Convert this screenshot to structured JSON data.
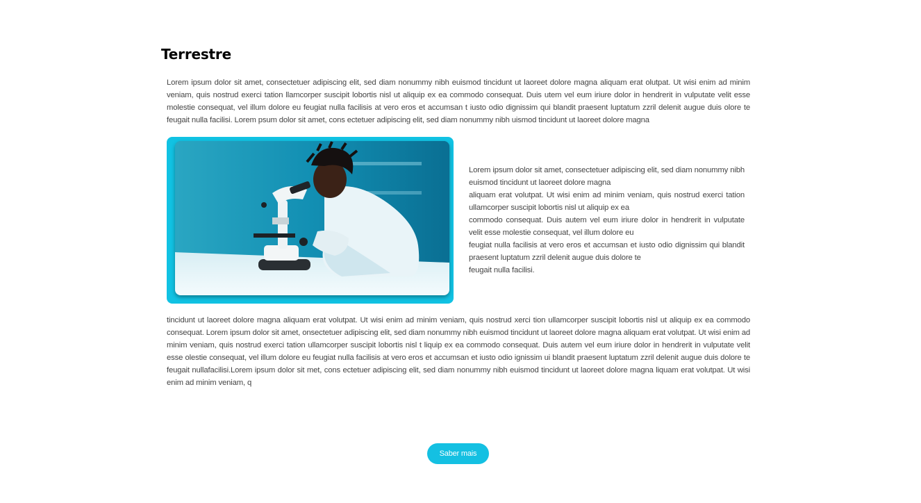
{
  "section": {
    "title": "Terrestre"
  },
  "intro_paragraph": "Lorem ipsum dolor sit amet, consectetuer adipiscing elit, sed diam nonummy nibh euismod tincidunt ut laoreet dolore magna aliquam erat  olutpat. Ut wisi enim ad minim veniam, quis nostrud exerci tation  llamcorper suscipit lobortis nisl ut aliquip ex ea commodo consequat. Duis utem vel eum iriure dolor in hendrerit in vulputate velit esse molestie  consequat, vel illum dolore eu feugiat nulla facilisis at vero eros et accumsan  t iusto odio dignissim qui blandit praesent luptatum zzril delenit augue duis  olore te feugait nulla facilisi. Lorem psum dolor sit amet, cons ectetuer adipiscing elit, sed diam nonummy nibh uismod tincidunt ut laoreet dolore magna",
  "side_paragraph_lines": [
    "Lorem ipsum dolor sit amet, consectetuer adipiscing elit, sed diam nonummy nibh euismod tincidunt ut laoreet dolore magna",
    "aliquam erat volutpat. Ut wisi enim ad minim veniam, quis nostrud exerci tation ullamcorper suscipit lobortis nisl ut aliquip ex ea",
    "commodo consequat. Duis autem vel eum iriure dolor in hendrerit in vulputate velit esse molestie consequat, vel illum dolore eu",
    "feugiat nulla facilisis at vero eros et accumsan et iusto odio dignissim qui blandit praesent luptatum zzril delenit augue duis dolore te",
    "feugait nulla facilisi."
  ],
  "bottom_paragraph": "tincidunt ut laoreet dolore magna aliquam erat volutpat. Ut wisi enim ad minim veniam, quis nostrud xerci tion ullamcorper suscipit lobortis nisl ut aliquip ex ea commodo consequat. Lorem ipsum dolor sit amet, onsectetuer adipiscing elit, sed diam nonummy nibh euismod tincidunt ut laoreet dolore magna aliquam erat volutpat. Ut wisi enim ad minim veniam, quis nostrud exerci tation ullamcorper suscipit lobortis nisl t liquip ex ea commodo consequat. Duis autem vel eum iriure dolor in hendrerit in vulputate velit esse olestie consequat, vel illum dolore eu feugiat nulla facilisis at vero eros et accumsan et iusto odio ignissim ui blandit praesent luptatum zzril delenit augue duis dolore te feugait nullafacilisi.Lorem ipsum dolor sit met, cons ectetuer adipiscing elit, sed diam nonummy nibh euismod tincidunt ut laoreet dolore magna liquam erat volutpat. Ut wisi enim ad minim veniam, q",
  "cta": {
    "label": "Saber mais"
  },
  "colors": {
    "accent": "#14c0e2",
    "frame": "#11c2e3",
    "title": "#000000",
    "body_text": "#444444"
  },
  "image": {
    "subject": "scientist-with-microscope-photo"
  }
}
